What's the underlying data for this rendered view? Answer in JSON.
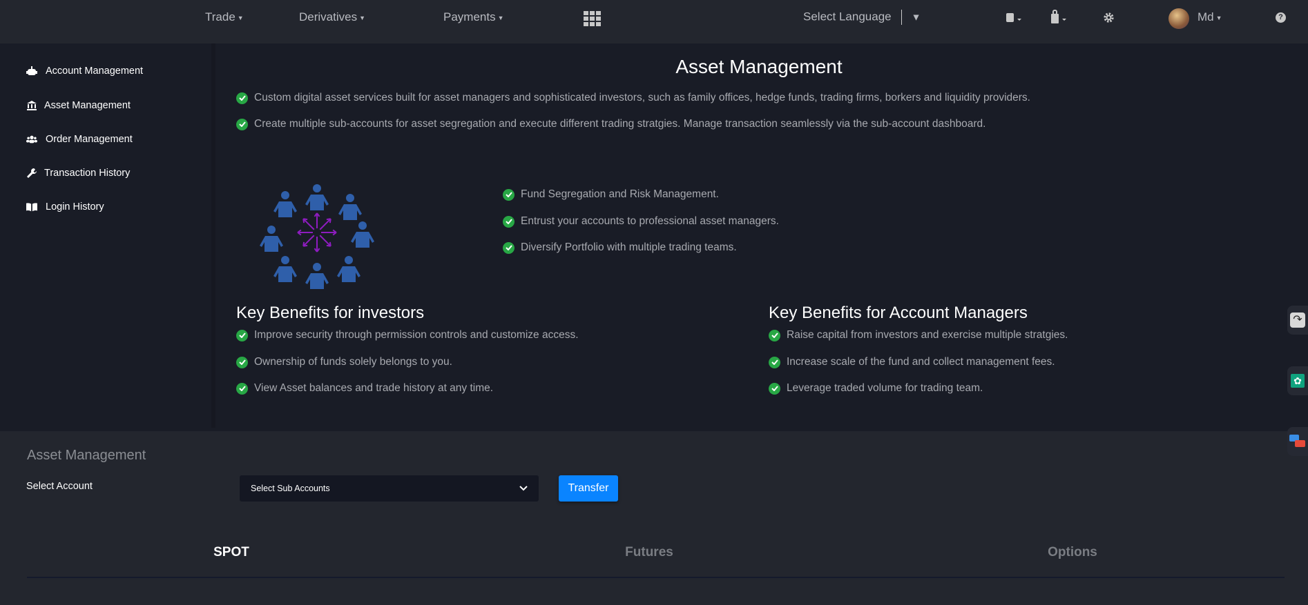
{
  "nav": {
    "items": [
      "Trade",
      "Derivatives",
      "Payments"
    ],
    "language": "Select Language",
    "user": "Md",
    "icons": [
      "apps-grid-icon",
      "book-icon",
      "wallet-icon",
      "gear-icon",
      "avatar",
      "help-icon"
    ]
  },
  "sidebar": {
    "items": [
      {
        "label": "Account Management",
        "icon": "robot-icon"
      },
      {
        "label": "Asset Management",
        "icon": "bank-icon"
      },
      {
        "label": "Order Management",
        "icon": "users-icon"
      },
      {
        "label": "Transaction History",
        "icon": "wrench-icon"
      },
      {
        "label": "Login History",
        "icon": "book-open-icon"
      }
    ]
  },
  "main": {
    "title": "Asset Management",
    "intro": [
      "Custom digital asset services built for asset managers and sophisticated investors, such as family offices, hedge funds, trading firms, borkers and liquidity providers.",
      "Create multiple sub-accounts for asset segregation and execute different trading stratgies. Manage transaction seamlessly via the sub-account dashboard."
    ],
    "features": [
      "Fund Segregation and Risk Management.",
      "Entrust your accounts to professional asset managers.",
      "Diversify Portfolio with multiple trading teams."
    ],
    "investors": {
      "title": "Key Benefits for investors",
      "items": [
        "Improve security through permission controls and customize access.",
        "Ownership of funds solely belongs to you.",
        "View Asset balances and trade history at any time."
      ]
    },
    "managers": {
      "title": "Key Benefits for Account Managers",
      "items": [
        "Raise capital from investors and exercise multiple stratgies.",
        "Increase scale of the fund and collect management fees.",
        "Leverage traded volume for trading team."
      ]
    }
  },
  "bottom": {
    "title": "Asset Management",
    "select_label": "Select Account",
    "select_value": "Select Sub Accounts",
    "transfer": "Transfer",
    "tabs": [
      "SPOT",
      "Futures",
      "Options"
    ],
    "active_tab": "SPOT"
  },
  "colors": {
    "accent": "#0a84ff",
    "check": "#28a745",
    "people": "#2f5faa",
    "arrows": "#8e1cc0"
  }
}
